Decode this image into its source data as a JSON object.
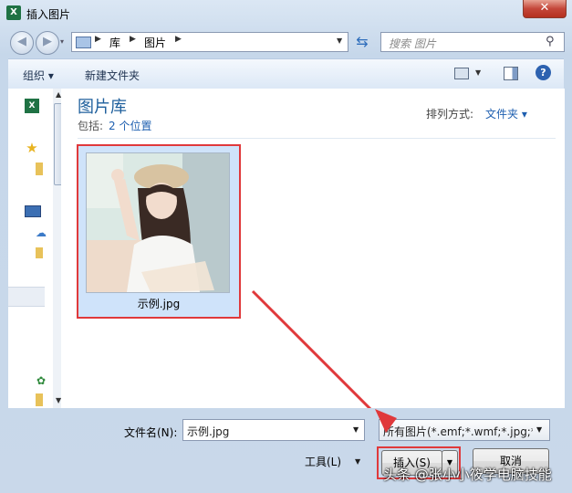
{
  "window": {
    "title": "插入图片",
    "app_icon": "excel-icon"
  },
  "nav": {
    "breadcrumbs": [
      "库",
      "图片"
    ],
    "search_placeholder": "搜索 图片"
  },
  "toolbar": {
    "organize": "组织 ▾",
    "new_folder": "新建文件夹"
  },
  "content": {
    "library_title": "图片库",
    "includes_label": "包括:",
    "locations_link": "2 个位置",
    "arrange_label": "排列方式:",
    "arrange_value": "文件夹 ▾",
    "files": [
      {
        "name": "示例.jpg"
      }
    ]
  },
  "bottom": {
    "filename_label": "文件名(N):",
    "filename_value": "示例.jpg",
    "filter_value": "所有图片(*.emf;*.wmf;*.jpg;*.jpeg;*.jfif;*.png)",
    "tools_label": "工具(L)",
    "insert_label": "插入(S)",
    "cancel_label": "取消"
  },
  "watermark": "头条 @张小小筱学电脑技能",
  "colors": {
    "highlight": "#e0393b",
    "accent": "#1e5f9c"
  }
}
